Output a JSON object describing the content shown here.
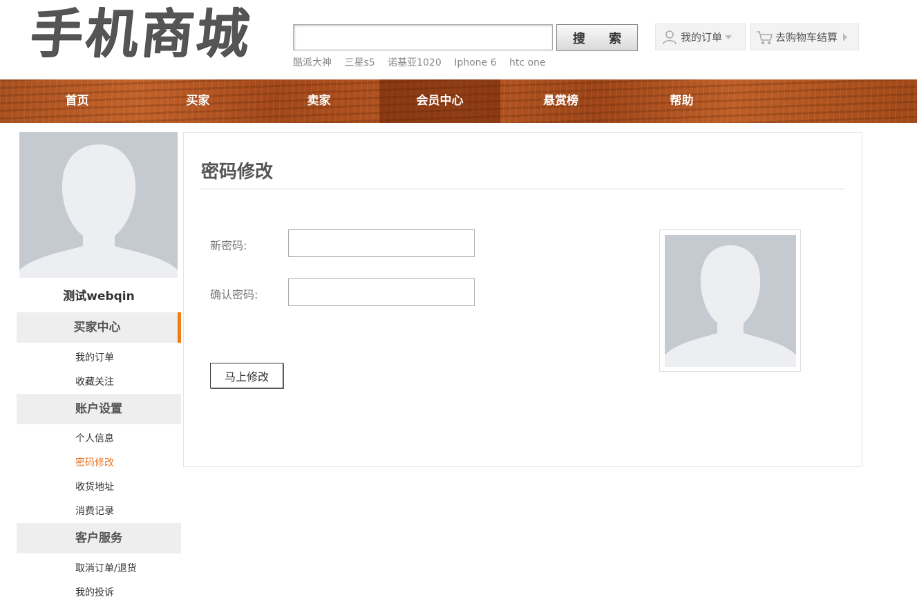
{
  "header": {
    "logo_text": "手机商城",
    "search": {
      "value": "",
      "placeholder": "",
      "button_label": "搜 索"
    },
    "hot_words": [
      "酷派大神",
      "三星s5",
      "诺基亚1020",
      "Iphone 6",
      "htc one"
    ],
    "my_orders_label": "我的订单",
    "cart_label": "去购物车结算"
  },
  "nav": {
    "items": [
      "首页",
      "买家",
      "卖家",
      "会员中心",
      "悬赏榜",
      "帮助"
    ],
    "active": "会员中心"
  },
  "sidebar": {
    "username": "测试webqin",
    "sections": [
      {
        "title": "买家中心",
        "links": [
          "我的订单",
          "收藏关注"
        ]
      },
      {
        "title": "账户设置",
        "links": [
          "个人信息",
          "密码修改",
          "收货地址",
          "消费记录"
        ]
      },
      {
        "title": "客户服务",
        "links": [
          "取消订单/退货",
          "我的投诉"
        ]
      }
    ],
    "active_section": "买家中心",
    "current_link": "密码修改"
  },
  "main": {
    "title": "密码修改",
    "new_password_label": "新密码:",
    "new_password_value": "",
    "confirm_password_label": "确认密码:",
    "confirm_password_value": "",
    "submit_label": "马上修改"
  },
  "colors": {
    "accent_orange": "#f07b13",
    "current_link": "#e8782a",
    "nav_wood": "#b25526",
    "avatar_bg": "#c5cad1"
  },
  "icons": {
    "user": "user-icon",
    "cart": "cart-icon",
    "dropdown": "chevron-down-icon",
    "arrow": "chevron-right-icon",
    "avatar": "avatar-placeholder-icon"
  }
}
